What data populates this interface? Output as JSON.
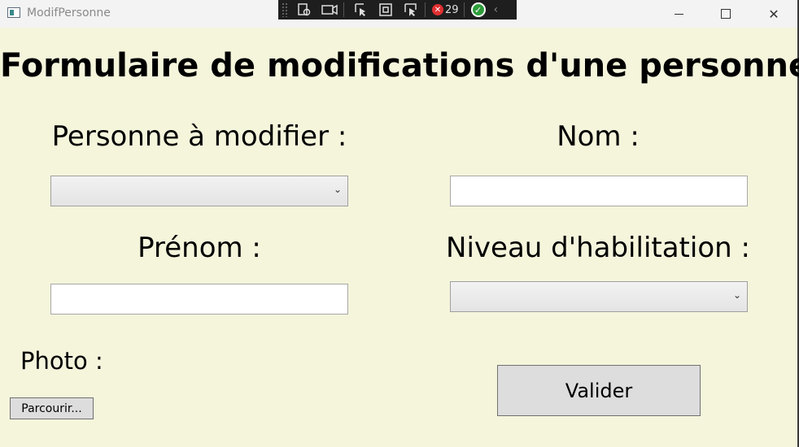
{
  "window": {
    "title": "ModifPersonne"
  },
  "debug_toolbar": {
    "error_count": "29"
  },
  "form": {
    "heading": "Formulaire de modifications d'une personne",
    "personne_label": "Personne à modifier :",
    "personne_selected": "",
    "nom_label": "Nom :",
    "nom_value": "",
    "prenom_label": "Prénom :",
    "prenom_value": "",
    "niveau_label": "Niveau d'habilitation :",
    "niveau_selected": "",
    "photo_label": "Photo :",
    "browse_button": "Parcourir...",
    "submit_button": "Valider"
  },
  "colors": {
    "background": "#f5f5dc",
    "button_bg": "#dddddd"
  }
}
